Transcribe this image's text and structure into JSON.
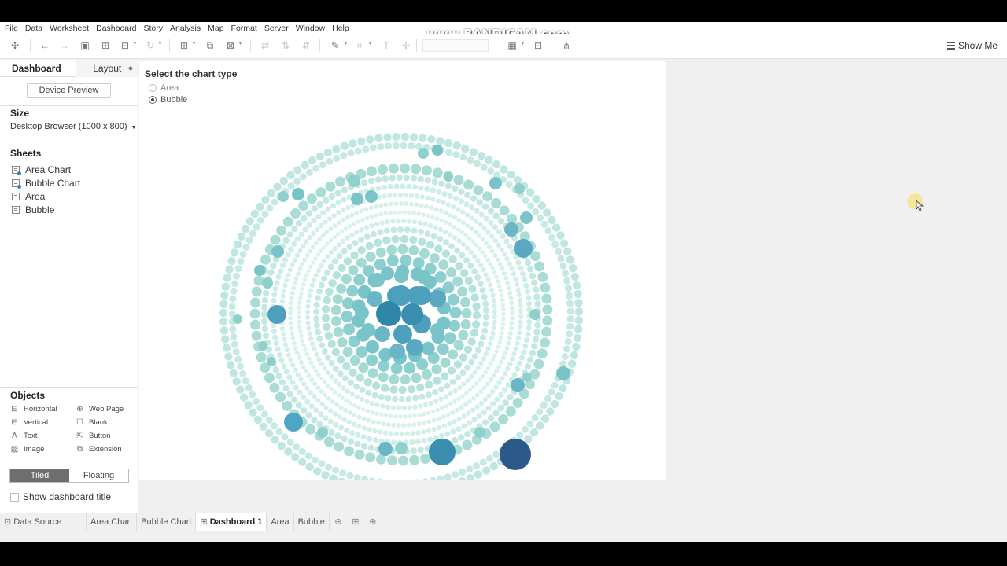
{
  "menu": [
    "File",
    "Data",
    "Worksheet",
    "Dashboard",
    "Story",
    "Analysis",
    "Map",
    "Format",
    "Server",
    "Window",
    "Help"
  ],
  "watermark": "www.BANDICAM.com",
  "toolbar": {
    "show_me_label": "Show Me"
  },
  "left_pane": {
    "tabs": {
      "dashboard": "Dashboard",
      "layout": "Layout"
    },
    "device_preview": "Device Preview",
    "size_title": "Size",
    "size_value": "Desktop Browser (1000 x 800)",
    "sheets_title": "Sheets",
    "sheets": [
      "Area Chart",
      "Bubble Chart",
      "Area",
      "Bubble"
    ],
    "objects_title": "Objects",
    "objects": {
      "horizontal": "Horizontal",
      "vertical": "Vertical",
      "text": "Text",
      "image": "Image",
      "web_page": "Web Page",
      "blank": "Blank",
      "button": "Button",
      "extension": "Extension"
    },
    "tiled": "Tiled",
    "floating": "Floating",
    "show_title": "Show dashboard title"
  },
  "dashboard": {
    "param_title": "Select the chart type",
    "options": [
      "Area",
      "Bubble"
    ],
    "selected": "Bubble"
  },
  "colors": {
    "dark": "#2b5a8a",
    "mid": "#3a8fb0",
    "light": "#a8dcd6",
    "accent": "#4ea6c4"
  },
  "bottom_tabs": [
    "Data Source",
    "Area Chart",
    "Bubble Chart",
    "Dashboard 1",
    "Area",
    "Bubble"
  ],
  "active_tab": "Dashboard 1"
}
